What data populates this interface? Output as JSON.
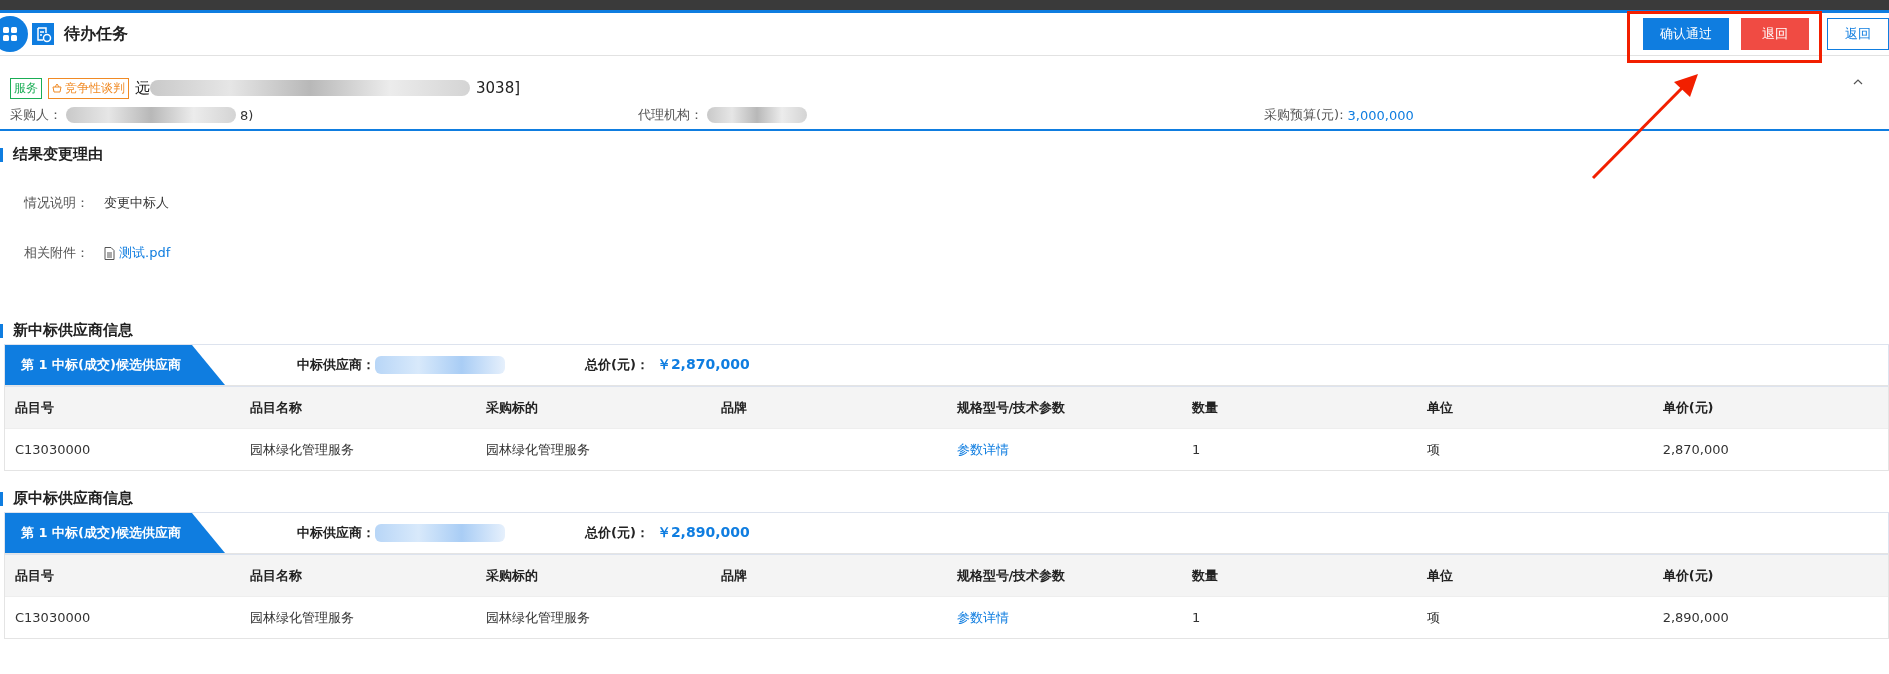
{
  "header": {
    "title": "待办任务",
    "buttons": [
      {
        "label": "确认通过",
        "kind": "primary"
      },
      {
        "label": "退回",
        "kind": "danger"
      },
      {
        "label": "返回",
        "kind": "outline"
      }
    ]
  },
  "project": {
    "tags": [
      {
        "label": "服务",
        "kind": "green"
      },
      {
        "label": "竞争性谈判",
        "kind": "orange"
      }
    ],
    "title_start": "远",
    "title_end": "3038]",
    "fields": [
      {
        "label": "采购人：",
        "value": "8)",
        "kind": "blurred"
      },
      {
        "label": "代理机构：",
        "kind": "blurred"
      },
      {
        "label": "采购预算(元):",
        "value": "3,000,000",
        "kind": "link"
      }
    ]
  },
  "reason": {
    "heading": "结果变更理由",
    "rows": [
      {
        "label": "情况说明：",
        "value": "变更中标人",
        "kind": "text"
      },
      {
        "label": "相关附件：",
        "value": "测试.pdf",
        "kind": "file"
      }
    ]
  },
  "suppliers": [
    {
      "heading": "新中标供应商信息",
      "rank_label": "第 1 中标(成交)候选供应商",
      "supplier_label": "中标供应商：",
      "total_label": "总价(元)：",
      "total": "￥2,870,000",
      "columns": [
        "品目号",
        "品目名称",
        "采购标的",
        "品牌",
        "规格型号/技术参数",
        "数量",
        "单位",
        "单价(元)"
      ],
      "rows": [
        {
          "code": "C13030000",
          "name": "园林绿化管理服务",
          "subject": "园林绿化管理服务",
          "params_link": "参数详情",
          "quantity": "1",
          "unit": "项",
          "unit_price": "2,870,000"
        }
      ]
    },
    {
      "heading": "原中标供应商信息",
      "rank_label": "第 1 中标(成交)候选供应商",
      "supplier_label": "中标供应商：",
      "total_label": "总价(元)：",
      "total": "￥2,890,000",
      "columns": [
        "品目号",
        "品目名称",
        "采购标的",
        "品牌",
        "规格型号/技术参数",
        "数量",
        "单位",
        "单价(元)"
      ],
      "rows": [
        {
          "code": "C13030000",
          "name": "园林绿化管理服务",
          "subject": "园林绿化管理服务",
          "params_link": "参数详情",
          "quantity": "1",
          "unit": "项",
          "unit_price": "2,890,000"
        }
      ]
    }
  ]
}
